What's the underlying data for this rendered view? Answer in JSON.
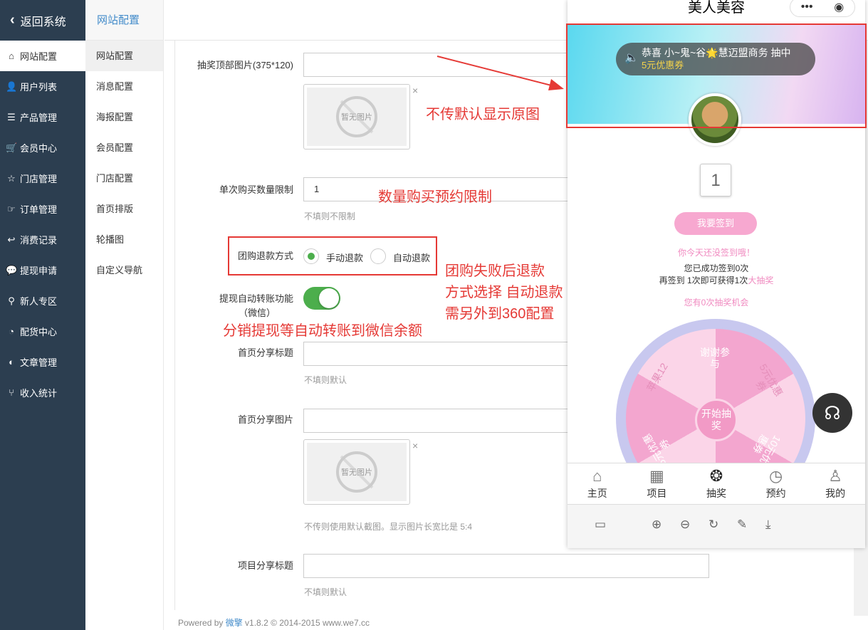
{
  "sidebar": {
    "back_label": "返回系统",
    "items": [
      {
        "icon": "home-icon",
        "glyph": "⌂",
        "label": "网站配置"
      },
      {
        "icon": "user-icon",
        "glyph": "👤",
        "label": "用户列表"
      },
      {
        "icon": "product-icon",
        "glyph": "☰",
        "label": "产品管理"
      },
      {
        "icon": "cart-icon",
        "glyph": "🛒",
        "label": "会员中心"
      },
      {
        "icon": "star-icon",
        "glyph": "☆",
        "label": "门店管理"
      },
      {
        "icon": "thumb-icon",
        "glyph": "☞",
        "label": "订单管理"
      },
      {
        "icon": "reply-icon",
        "glyph": "↩",
        "label": "消费记录"
      },
      {
        "icon": "wechat-icon",
        "glyph": "💬",
        "label": "提现申请"
      },
      {
        "icon": "pin-icon",
        "glyph": "⚲",
        "label": "新人专区"
      },
      {
        "icon": "pie-icon",
        "glyph": "◔",
        "label": "配货中心"
      },
      {
        "icon": "contrast-icon",
        "glyph": "◐",
        "label": "文章管理"
      },
      {
        "icon": "branch-icon",
        "glyph": "⑂",
        "label": "收入统计"
      }
    ]
  },
  "submenu": {
    "title": "网站配置",
    "items": [
      "网站配置",
      "消息配置",
      "海报配置",
      "会员配置",
      "门店配置",
      "首页排版",
      "轮播图",
      "自定义导航"
    ]
  },
  "form": {
    "lottery_label": "抽奖顶部图片(375*120)",
    "no_image_text": "暂无图片",
    "close_mark": "×",
    "limit_label": "单次购买数量限制",
    "limit_value": "1",
    "limit_hint": "不填则不限制",
    "refund_label": "团购退款方式",
    "refund_manual": "手动退款",
    "refund_auto": "自动退款",
    "transfer_label": "提现自动转账功能",
    "transfer_sub": "（微信）",
    "share_title_label": "首页分享标题",
    "share_title_hint": "不填则默认",
    "share_img_label": "首页分享图片",
    "share_img_hint": "不传则使用默认截图。显示图片长宽比是 5:4",
    "project_title_label": "项目分享标题",
    "project_title_hint": "不填则默认"
  },
  "footer": {
    "prefix": "Powered by ",
    "brand": "微擎",
    "rest": " v1.8.2 © 2014-2015 www.we7.cc"
  },
  "annotations": {
    "a1": "不传默认显示原图",
    "a2": "数量购买预约限制",
    "a3_1": "团购失败后退款",
    "a3_2": "方式选择 自动退款",
    "a3_3": "需另外到360配置",
    "a4": "分销提现等自动转账到微信余额"
  },
  "phone": {
    "title": "美人美容",
    "caps_more": "•••",
    "caps_close": "◉",
    "notice_line1": "恭喜 小~鬼~谷🌟慧迈盟商务 抽中",
    "notice_line2": "5元优惠券",
    "day_count": "1",
    "signin_btn": "我要签到",
    "not_signed": "你今天还没签到哦！",
    "signed_days": "您已成功签到0次",
    "more_pre": "再签到 1次即可获得1次",
    "more_link": "大抽奖",
    "chances": "您有0次抽奖机会",
    "prize1": "谢谢参与",
    "prize2": "5元优惠券",
    "prize3": "10元优惠券",
    "prize5": "5元优惠券",
    "prize6": "苹果12",
    "wheel_start": "开始抽奖",
    "tabs": [
      {
        "icon": "home-icon",
        "glyph": "⌂",
        "label": "主页"
      },
      {
        "icon": "grid-icon",
        "glyph": "▦",
        "label": "项目"
      },
      {
        "icon": "lottery-icon",
        "glyph": "❂",
        "label": "抽奖"
      },
      {
        "icon": "clock-icon",
        "glyph": "◷",
        "label": "预约"
      },
      {
        "icon": "profile-icon",
        "glyph": "♙",
        "label": "我的"
      }
    ]
  },
  "colors": {
    "sidebar": "#2c3e50",
    "accent": "#428bca",
    "green": "#4cae4c",
    "annotation": "#e53935",
    "pink": "#f3a6cf"
  }
}
